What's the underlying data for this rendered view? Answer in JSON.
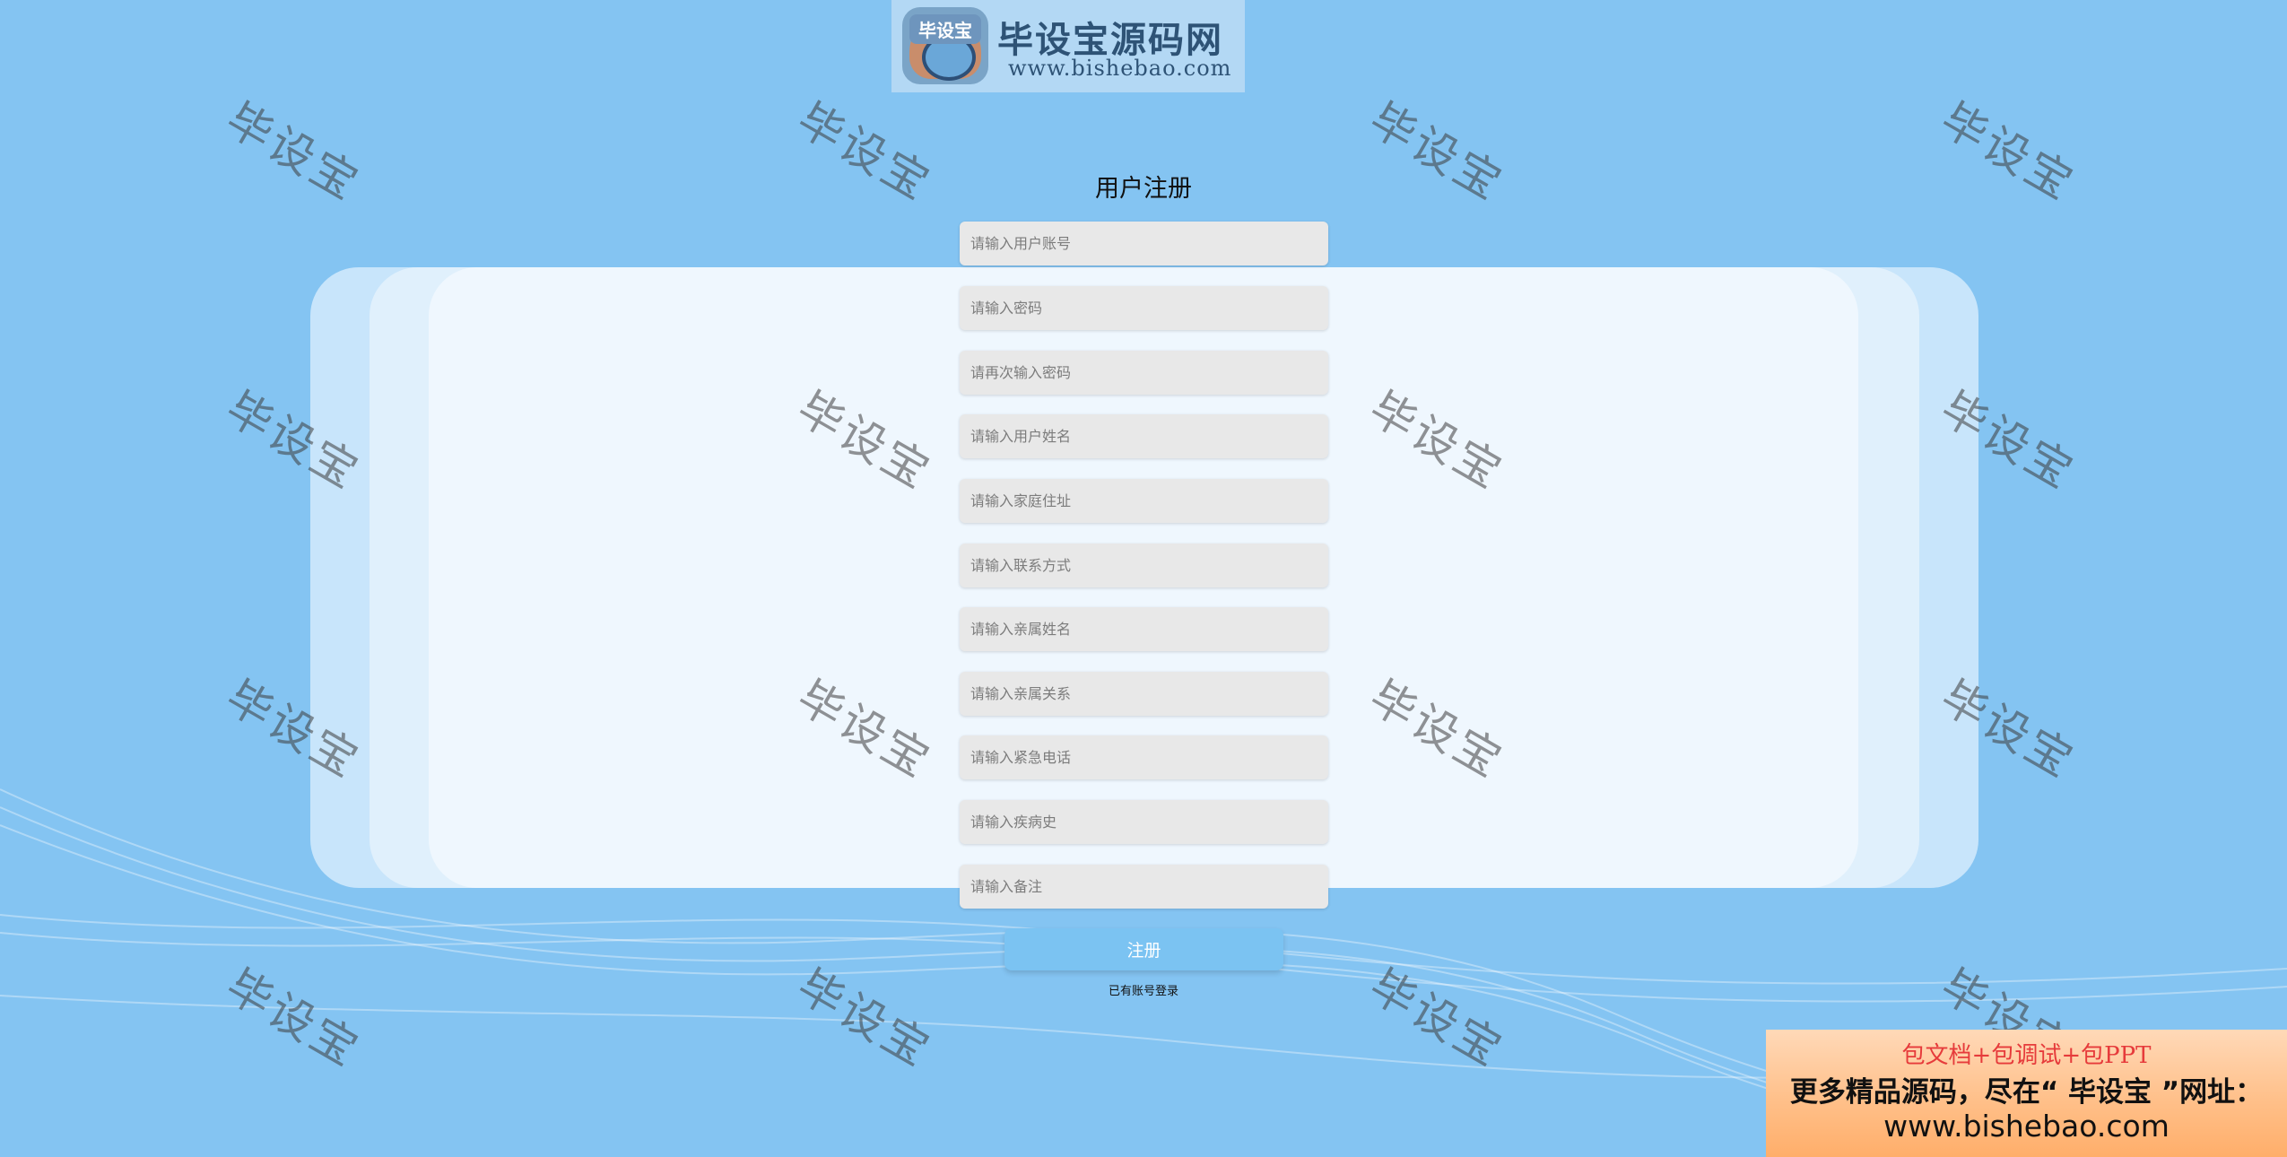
{
  "logo": {
    "badge_text": "毕设宝",
    "title": "毕设宝源码网",
    "url": "www.bishebao.com"
  },
  "watermark_text": "毕设宝",
  "form": {
    "title": "用户注册",
    "fields": [
      {
        "placeholder": "请输入用户账号"
      },
      {
        "placeholder": "请输入密码"
      },
      {
        "placeholder": "请再次输入密码"
      },
      {
        "placeholder": "请输入用户姓名"
      },
      {
        "placeholder": "请输入家庭住址"
      },
      {
        "placeholder": "请输入联系方式"
      },
      {
        "placeholder": "请输入亲属姓名"
      },
      {
        "placeholder": "请输入亲属关系"
      },
      {
        "placeholder": "请输入紧急电话"
      },
      {
        "placeholder": "请输入疾病史"
      },
      {
        "placeholder": "请输入备注"
      }
    ],
    "submit_label": "注册",
    "login_link": "已有账号登录"
  },
  "promo": {
    "line1": "包文档+包调试+包PPT",
    "line2": "更多精品源码，尽在“ 毕设宝 ”网址：",
    "line3": "www.bishebao.com"
  },
  "colors": {
    "background": "#84c4f2",
    "button": "#7bc3f2",
    "field": "#e8e8e8",
    "promo_accent": "#e63b3b"
  }
}
